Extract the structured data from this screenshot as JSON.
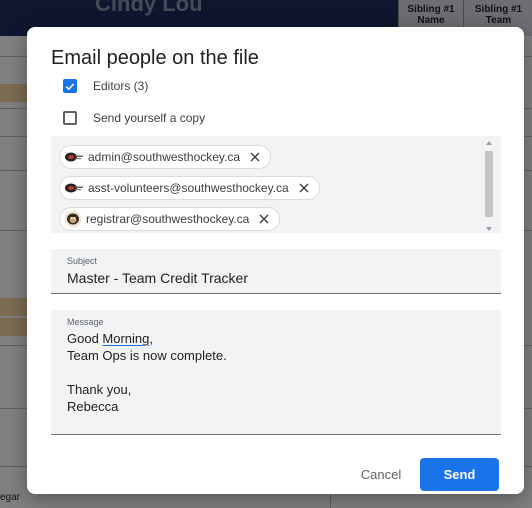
{
  "background": {
    "sheet_title": "Cindy Lou",
    "col_headers": [
      "Sibling #1 Name",
      "Sibling #1 Team"
    ],
    "bottom_text": "egar"
  },
  "dialog": {
    "title": "Email people on the file",
    "editors_label": "Editors (3)",
    "editors_checked": true,
    "send_copy_label": "Send yourself a copy",
    "send_copy_checked": false,
    "recipients": [
      {
        "email": "admin@southwesthockey.ca",
        "avatar": "team-logo-icon"
      },
      {
        "email": "asst-volunteers@southwesthockey.ca",
        "avatar": "team-logo-icon"
      },
      {
        "email": "registrar@southwesthockey.ca",
        "avatar": "profile-photo-icon"
      }
    ],
    "subject_label": "Subject",
    "subject_value": "Master - Team Credit Tracker",
    "message_label": "Message",
    "message_lines": [
      "Good Morning,",
      "Team Ops is now complete.",
      "",
      "Thank you,",
      "Rebecca"
    ],
    "cancel_label": "Cancel",
    "send_label": "Send",
    "accent_color": "#1a73e8"
  }
}
